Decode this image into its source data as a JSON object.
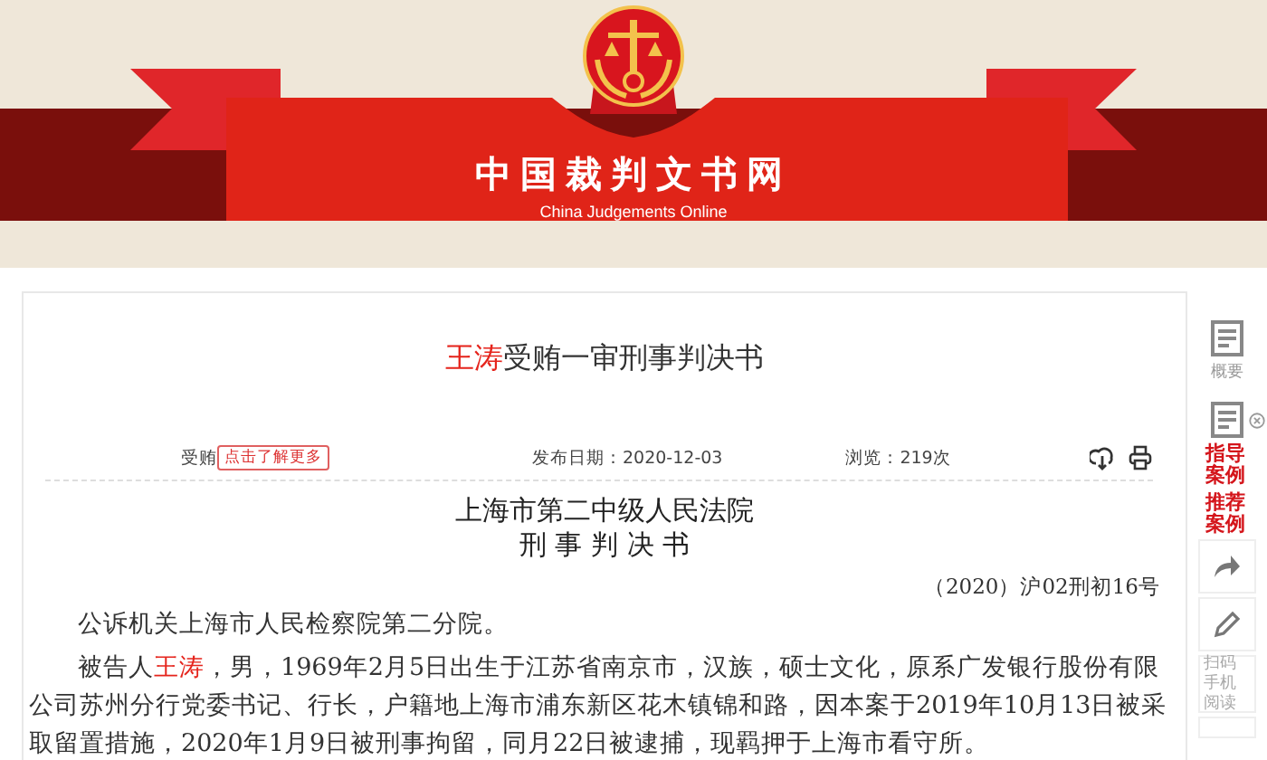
{
  "header": {
    "site_name": "中国裁判文书网",
    "site_subtitle": "China Judgements Online"
  },
  "document": {
    "title": [
      {
        "text": "王涛",
        "highlight": true
      },
      {
        "text": "受贿一审刑事判决书",
        "highlight": false
      }
    ],
    "meta": {
      "cause": "受贿",
      "tag": "点击了解更多",
      "publish_date": "发布日期：2020-12-03",
      "views": "浏览：219次"
    },
    "court": "上海市第二中级人民法院",
    "doc_type": "刑 事 判 决 书",
    "case_number": "（2020）沪02刑初16号",
    "paragraphs": [
      [
        {
          "text": "公诉机关上海市人民检察院第二分院。",
          "highlight": false
        }
      ],
      [
        {
          "text": "被告人",
          "highlight": false
        },
        {
          "text": "王涛",
          "highlight": true
        },
        {
          "text": "，男，1969年2月5日出生于江苏省南京市，汉族，硕士文化，原系广发银行股份有限公司苏州分行党委书记、行长，户籍地上海市浦东新区花木镇锦和路，因本案于2019年10月13日被采取留置措施，2020年1月9日被刑事拘留，同月22日被逮捕，现羁押于上海市看守所。",
          "highlight": false
        }
      ]
    ]
  },
  "sidebar": [
    {
      "kind": "doc",
      "label": "概要"
    },
    {
      "kind": "doc-close"
    },
    {
      "kind": "link",
      "label": "指导案例"
    },
    {
      "kind": "link",
      "label": "推荐案例"
    },
    {
      "kind": "share"
    },
    {
      "kind": "edit"
    },
    {
      "kind": "text",
      "label": "扫码手机阅读"
    },
    {
      "kind": "more"
    }
  ]
}
